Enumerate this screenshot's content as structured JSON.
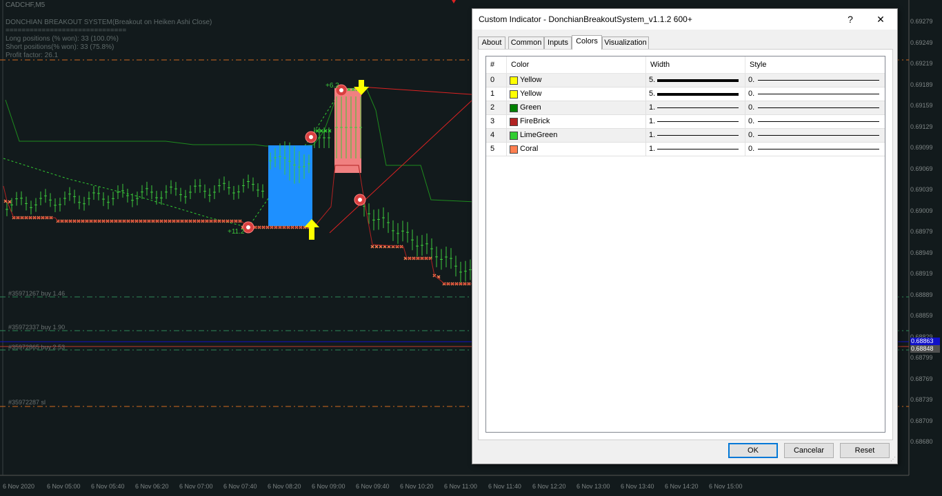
{
  "chart": {
    "symbol_tf": "CADCHF,M5",
    "indicator_title": "DONCHIAN BREAKOUT SYSTEM(Breakout on Heiken Ashi Close)",
    "separator": "==============================",
    "long_stats": "Long positions (% won): 33 (100.0%)",
    "short_stats": "Short positions(% won): 33 (75.8%)",
    "profit_label": "Profit factor: 26.1",
    "labels": {
      "plus11": "+11.2",
      "plus6": "+6.2",
      "order1": "#35971267 buy 1.46",
      "order2": "#35972337 buy 1.90",
      "order3": "#35972865 buy 2.53",
      "order_sl": "#35972287 sl"
    },
    "price_axis": [
      "0.69279",
      "0.69249",
      "0.69219",
      "0.69189",
      "0.69159",
      "0.69129",
      "0.69099",
      "0.69069",
      "0.69039",
      "0.69009",
      "0.68979",
      "0.68949",
      "0.68919",
      "0.68889",
      "0.68859",
      "0.68829",
      "0.68799",
      "0.68769",
      "0.68739",
      "0.68709",
      "0.68680"
    ],
    "bid_box": "0.68863",
    "ask_box": "0.68848",
    "time_axis": [
      "6 Nov 2020",
      "6 Nov 05:00",
      "6 Nov 05:40",
      "6 Nov 06:20",
      "6 Nov 07:00",
      "6 Nov 07:40",
      "6 Nov 08:20",
      "6 Nov 09:00",
      "6 Nov 09:40",
      "6 Nov 10:20",
      "6 Nov 11:00",
      "6 Nov 11:40",
      "6 Nov 12:20",
      "6 Nov 13:00",
      "6 Nov 13:40",
      "6 Nov 14:20",
      "6 Nov 15:00"
    ],
    "colors": {
      "bg": "#121a1c",
      "up_candle": "#3cc83c",
      "donchian": "#1e8c1e",
      "marker": "#ff7f50",
      "blue_box": "#1e90ff",
      "coral_box": "#f08080",
      "arrow": "#ffff00"
    }
  },
  "dialog": {
    "title": "Custom Indicator - DonchianBreakoutSystem_v1.1.2 600+",
    "help_btn": "?",
    "close_btn": "✕",
    "tabs": [
      "About",
      "Common",
      "Inputs",
      "Colors",
      "Visualization"
    ],
    "active_tab": "Colors",
    "columns": [
      "#",
      "Color",
      "Width",
      "Style"
    ],
    "rows": [
      {
        "index": "0",
        "color_name": "Yellow",
        "swatch": "#ffff00",
        "width": "5.",
        "style": "0."
      },
      {
        "index": "1",
        "color_name": "Yellow",
        "swatch": "#ffff00",
        "width": "5.",
        "style": "0."
      },
      {
        "index": "2",
        "color_name": "Green",
        "swatch": "#008000",
        "width": "1.",
        "style": "0."
      },
      {
        "index": "3",
        "color_name": "FireBrick",
        "swatch": "#b22222",
        "width": "1.",
        "style": "0."
      },
      {
        "index": "4",
        "color_name": "LimeGreen",
        "swatch": "#32cd32",
        "width": "1.",
        "style": "0."
      },
      {
        "index": "5",
        "color_name": "Coral",
        "swatch": "#ff7f50",
        "width": "1.",
        "style": "0."
      }
    ],
    "buttons": {
      "ok": "OK",
      "cancel": "Cancelar",
      "reset": "Reset"
    }
  }
}
